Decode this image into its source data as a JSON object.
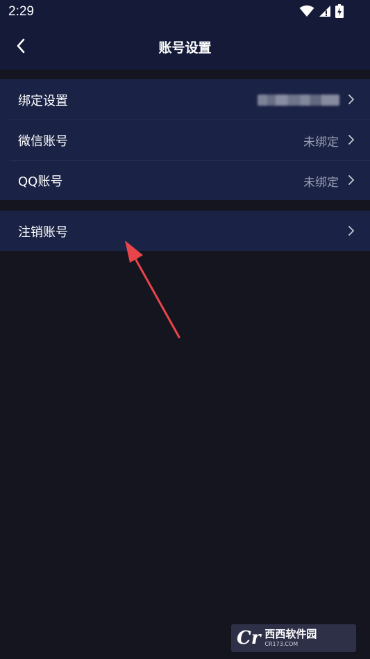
{
  "status_bar": {
    "time": "2:29"
  },
  "header": {
    "title": "账号设置"
  },
  "groups": [
    {
      "rows": [
        {
          "label": "绑定设置",
          "value": ""
        },
        {
          "label": "微信账号",
          "value": "未绑定"
        },
        {
          "label": "QQ账号",
          "value": "未绑定"
        }
      ]
    },
    {
      "rows": [
        {
          "label": "注销账号",
          "value": ""
        }
      ]
    }
  ],
  "watermark": {
    "logo": "Cr",
    "text": "西西软件园",
    "url_text": "CR173.COM"
  },
  "colors": {
    "header_bg": "#141a38",
    "page_bg": "#14151e",
    "row_bg": "#1a2245",
    "value_text": "#9aa0b4",
    "annotation_arrow": "#e8454b"
  }
}
